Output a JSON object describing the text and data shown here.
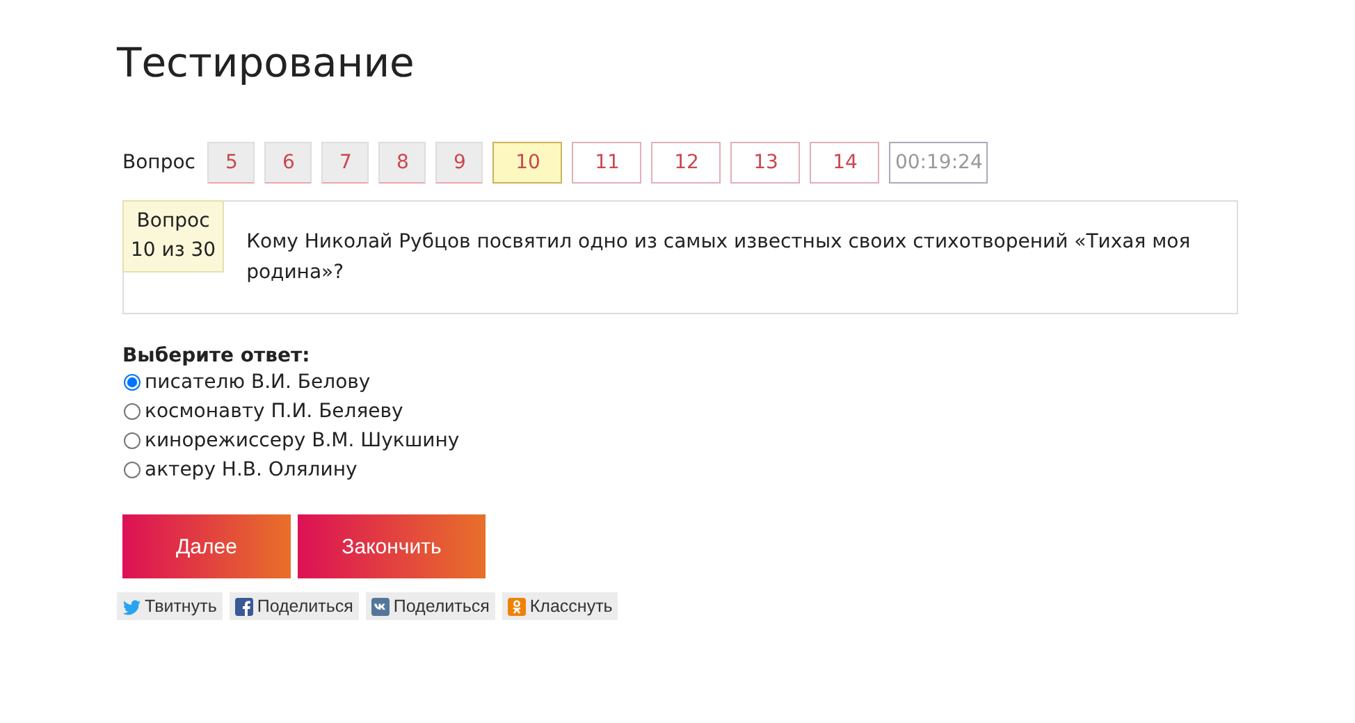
{
  "title": "Тестирование",
  "nav": {
    "label": "Вопрос",
    "questions": [
      {
        "number": "5",
        "visited": true,
        "selected": false
      },
      {
        "number": "6",
        "visited": true,
        "selected": false
      },
      {
        "number": "7",
        "visited": true,
        "selected": false
      },
      {
        "number": "8",
        "visited": true,
        "selected": false
      },
      {
        "number": "9",
        "visited": true,
        "selected": false
      },
      {
        "number": "10",
        "visited": false,
        "selected": true
      },
      {
        "number": "11",
        "visited": false,
        "selected": false
      },
      {
        "number": "12",
        "visited": false,
        "selected": false
      },
      {
        "number": "13",
        "visited": false,
        "selected": false
      },
      {
        "number": "14",
        "visited": false,
        "selected": false
      }
    ],
    "timer": "00:19:24"
  },
  "question": {
    "badge_line_1": "Вопрос",
    "badge_line_2": "10 из 30",
    "text": "Кому Николай Рубцов посвятил одно из самых известных своих стихотворений «Тихая моя родина»?"
  },
  "answers": {
    "heading": "Выберите ответ:",
    "options": [
      {
        "label": "писателю В.И. Белову",
        "selected": true
      },
      {
        "label": "космонавту П.И. Беляеву",
        "selected": false
      },
      {
        "label": "кинорежиссеру В.М. Шукшину",
        "selected": false
      },
      {
        "label": "актеру Н.В. Олялину",
        "selected": false
      }
    ]
  },
  "buttons": [
    "Далее",
    "Закончить"
  ],
  "share": [
    {
      "kind": "twitter",
      "label": "Твитнуть"
    },
    {
      "kind": "facebook",
      "label": "Поделиться"
    },
    {
      "kind": "vk",
      "label": "Поделиться"
    },
    {
      "kind": "ok",
      "label": "Класснуть"
    }
  ]
}
